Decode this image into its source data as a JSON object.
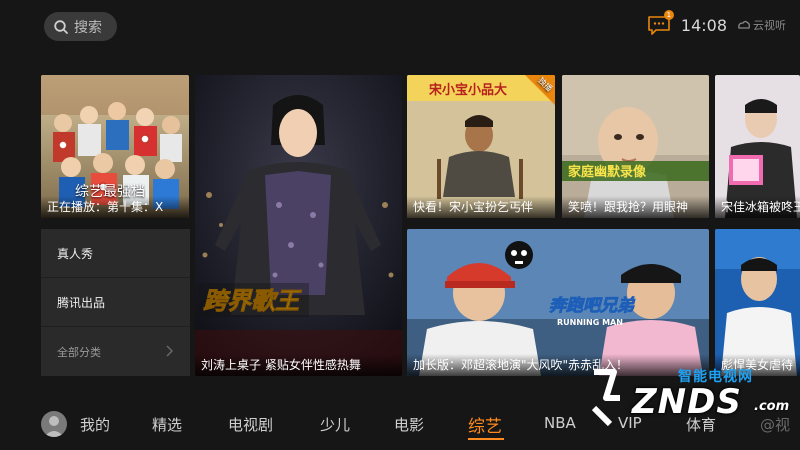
{
  "header": {
    "search_label": "搜索",
    "clock": "14:08",
    "notification_count": "1",
    "brand_text": "云视听"
  },
  "tiles": {
    "variety_top": {
      "title": "综艺最强档",
      "caption": "正在播放：第十集：X"
    },
    "singer": {
      "art_text": "跨界歌王",
      "caption": "刘涛上桌子 紧贴女伴性感热舞"
    },
    "song_xiaobao": {
      "sign": "宋小宝小品大",
      "vip": "独播",
      "caption": "快看！宋小宝扮乞丐伴"
    },
    "baby": {
      "sign": "家庭幽默录像",
      "caption": "笑喷！跟我抢？用眼神"
    },
    "running_man": {
      "logo_cn": "奔跑吧兄弟",
      "logo_en": "RUNNING MAN",
      "caption": "加长版：邓超滚地演\"大风吹\"赤赤乱入！"
    },
    "fridge": {
      "caption": "宋佳冰箱被咚王"
    },
    "host": {
      "caption": "彪悍美女虐待"
    }
  },
  "categories": [
    {
      "label": "真人秀"
    },
    {
      "label": "腾讯出品"
    },
    {
      "label": "全部分类"
    }
  ],
  "bottom_nav": {
    "items": [
      {
        "label": "我的"
      },
      {
        "label": "精选"
      },
      {
        "label": "电视剧"
      },
      {
        "label": "少儿"
      },
      {
        "label": "电影"
      },
      {
        "label": "综艺"
      },
      {
        "label": "NBA"
      },
      {
        "label": "VIP"
      },
      {
        "label": "体育"
      },
      {
        "label": "@视"
      }
    ],
    "active": "综艺"
  },
  "watermark": {
    "cn": "智能电视网",
    "main": "ZNDS",
    "suffix": ".com"
  },
  "colors": {
    "accent": "#ff8a1f",
    "background": "#161616",
    "panel": "#2a2a2a"
  }
}
